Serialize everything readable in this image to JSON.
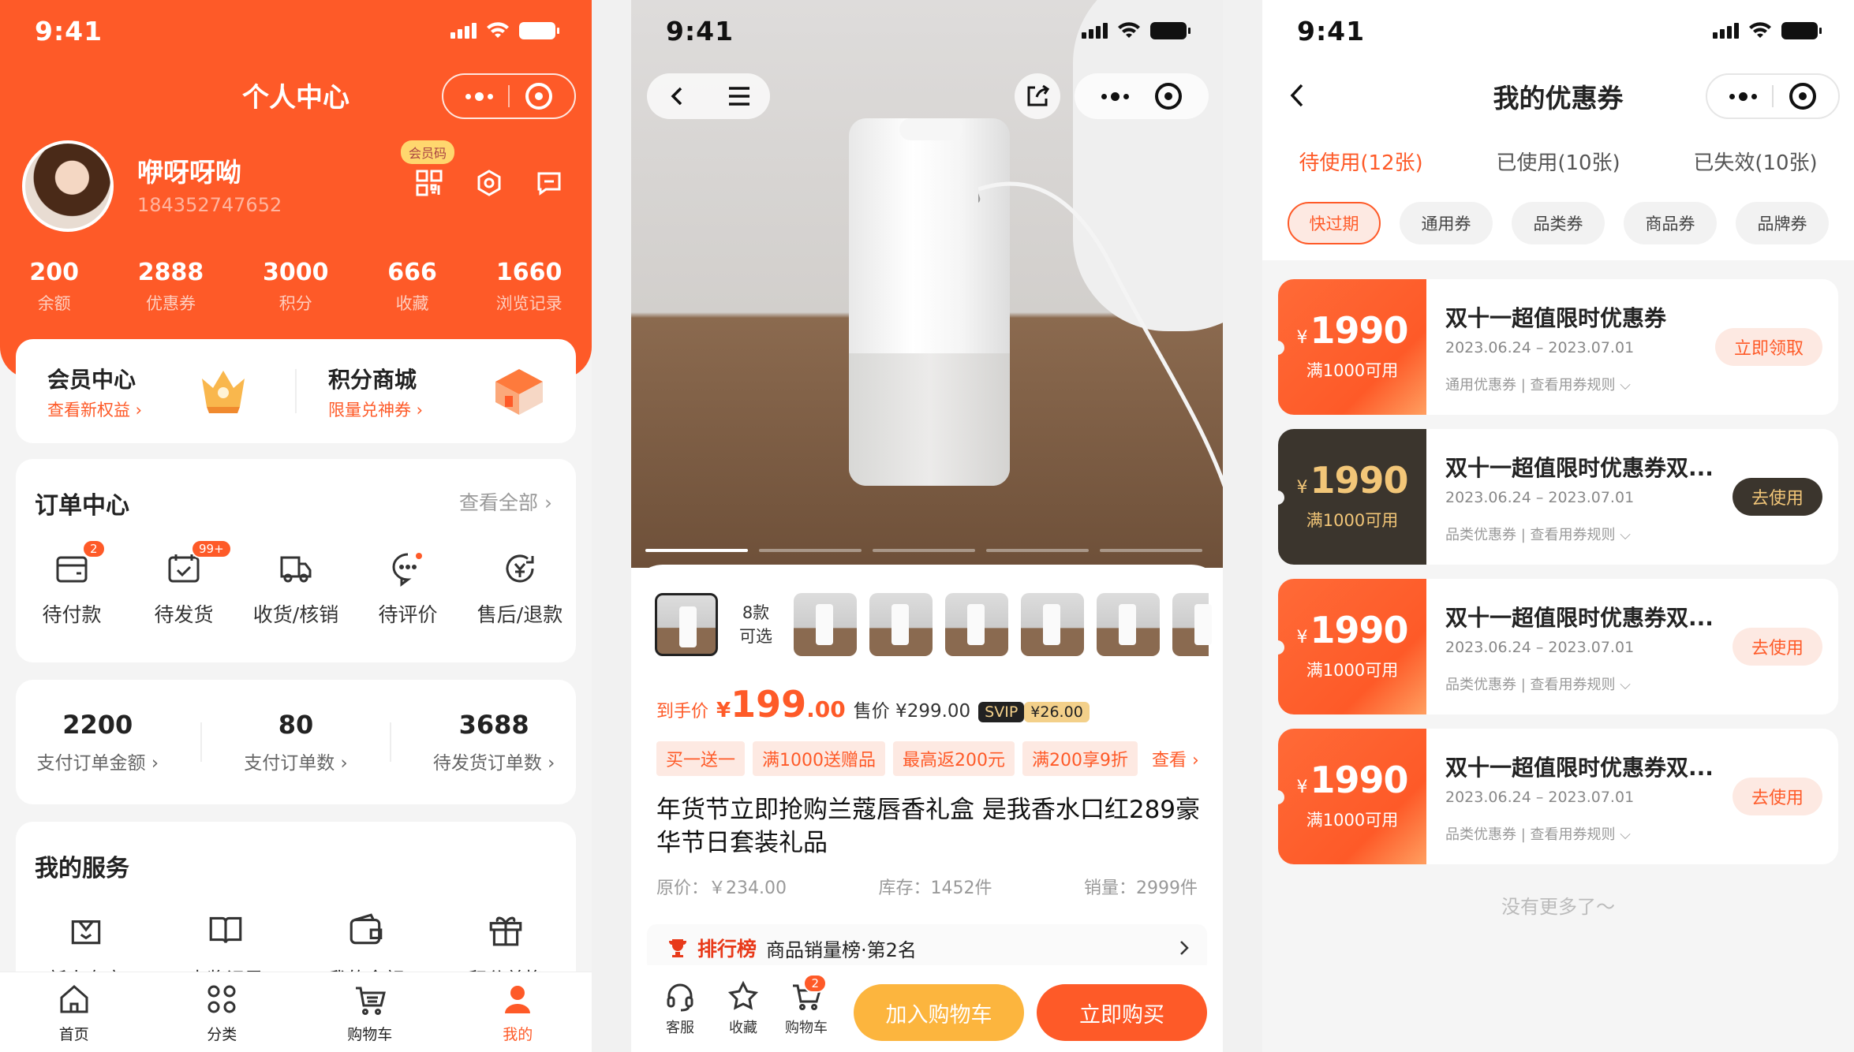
{
  "status": {
    "time": "9:41"
  },
  "profile": {
    "title": "个人中心",
    "name": "咿呀呀呦",
    "id": "184352747652",
    "member_code_badge": "会员码",
    "stats": [
      {
        "value": "200",
        "label": "余额"
      },
      {
        "value": "2888",
        "label": "优惠券"
      },
      {
        "value": "3000",
        "label": "积分"
      },
      {
        "value": "666",
        "label": "收藏"
      },
      {
        "value": "1660",
        "label": "浏览记录"
      }
    ],
    "member_center": {
      "title": "会员中心",
      "sub": "查看新权益 ›"
    },
    "points_mall": {
      "title": "积分商城",
      "sub": "限量兑神券 ›"
    },
    "orders": {
      "title": "订单中心",
      "more": "查看全部 ›",
      "items": [
        {
          "label": "待付款",
          "badge": "2",
          "icon": "wallet-icon"
        },
        {
          "label": "待发货",
          "badge": "99+",
          "icon": "calendar-check-icon"
        },
        {
          "label": "收货/核销",
          "badge": "",
          "icon": "truck-icon"
        },
        {
          "label": "待评价",
          "badge": "",
          "icon": "comment-icon"
        },
        {
          "label": "售后/退款",
          "badge": "",
          "icon": "refund-icon"
        }
      ]
    },
    "sales": [
      {
        "value": "2200",
        "label": "支付订单金额 ›"
      },
      {
        "value": "80",
        "label": "支付订单数 ›"
      },
      {
        "value": "3688",
        "label": "待发货订单数 ›"
      }
    ],
    "services": {
      "title": "我的服务",
      "items": [
        {
          "label": "新人专享",
          "icon": "gift-box-icon"
        },
        {
          "label": "中奖记录",
          "icon": "book-icon"
        },
        {
          "label": "我的余额",
          "icon": "wallet-icon"
        },
        {
          "label": "积分兑换",
          "icon": "gift-icon"
        }
      ]
    },
    "tabbar": [
      {
        "label": "首页",
        "icon": "home-icon"
      },
      {
        "label": "分类",
        "icon": "grid-icon"
      },
      {
        "label": "购物车",
        "icon": "cart-icon"
      },
      {
        "label": "我的",
        "icon": "user-icon",
        "active": true
      }
    ]
  },
  "product": {
    "variants_label": "8款\n可选",
    "price_tag": "到手价",
    "price_symbol": "¥",
    "price_int": "199",
    "price_dec": ".00",
    "sale_price": "售价 ¥299.00",
    "svip_label": "SVIP",
    "svip_price": "¥26.00",
    "promos": [
      "买一送一",
      "满1000送赠品",
      "最高返200元",
      "满200享9折"
    ],
    "promo_more": "查看 ›",
    "title": "年货节立即抢购兰蔻唇香礼盒 是我香水口红289豪华节日套装礼品",
    "original": "原价：￥234.00",
    "stock": "库存：1452件",
    "sold": "销量：2999件",
    "rank_label": "排行榜",
    "rank_text": "商品销量榜·第2名",
    "bottom": [
      {
        "label": "客服",
        "icon": "headset-icon"
      },
      {
        "label": "收藏",
        "icon": "star-icon"
      },
      {
        "label": "购物车",
        "icon": "cart-icon",
        "badge": "2"
      }
    ],
    "add_cart": "加入购物车",
    "buy_now": "立即购买"
  },
  "coupons": {
    "title": "我的优惠券",
    "tabs": [
      "待使用(12张)",
      "已使用(10张)",
      "已失效(10张)"
    ],
    "chips": [
      "快过期",
      "通用券",
      "品类券",
      "商品券",
      "品牌券"
    ],
    "list": [
      {
        "amount": "1990",
        "cond": "满1000可用",
        "name": "双十一超值限时优惠券",
        "date": "2023.06.24 – 2023.07.01",
        "rule": "通用优惠券 | 查看用券规则 ⌵",
        "action": "立即领取",
        "dark": false
      },
      {
        "amount": "1990",
        "cond": "满1000可用",
        "name": "双十一超值限时优惠券双...",
        "date": "2023.06.24 – 2023.07.01",
        "rule": "品类优惠券 | 查看用券规则 ⌵",
        "action": "去使用",
        "dark": true
      },
      {
        "amount": "1990",
        "cond": "满1000可用",
        "name": "双十一超值限时优惠券双...",
        "date": "2023.06.24 – 2023.07.01",
        "rule": "品类优惠券 | 查看用券规则 ⌵",
        "action": "去使用",
        "dark": false
      },
      {
        "amount": "1990",
        "cond": "满1000可用",
        "name": "双十一超值限时优惠券双...",
        "date": "2023.06.24 – 2023.07.01",
        "rule": "品类优惠券 | 查看用券规则 ⌵",
        "action": "去使用",
        "dark": false
      }
    ],
    "no_more": "没有更多了～",
    "currency": "¥"
  },
  "colors": {
    "accent": "#fe5a28",
    "gold": "#fcb53e",
    "dark": "#3b352d"
  }
}
